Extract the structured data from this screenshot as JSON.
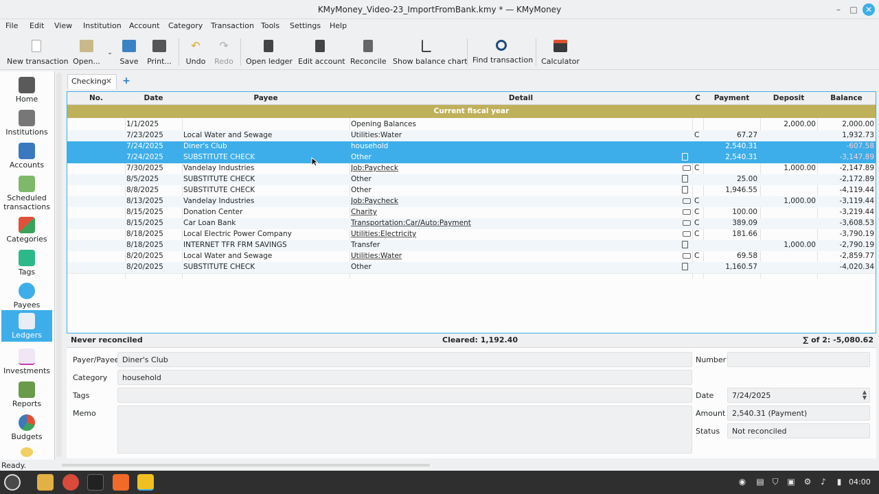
{
  "window": {
    "title": "KMyMoney_Video-23_ImportFromBank.kmy * — KMyMoney"
  },
  "menu": [
    "File",
    "Edit",
    "View",
    "Institution",
    "Account",
    "Category",
    "Transaction",
    "Tools",
    "Settings",
    "Help"
  ],
  "toolbar": {
    "new_transaction": "New transaction",
    "open": "Open...",
    "save": "Save",
    "print": "Print...",
    "undo": "Undo",
    "redo": "Redo",
    "open_ledger": "Open ledger",
    "edit_account": "Edit account",
    "reconcile": "Reconcile",
    "show_balance_chart": "Show balance chart",
    "find_transaction": "Find transaction",
    "calculator": "Calculator"
  },
  "sidebar": [
    {
      "label": "Home",
      "icon": "home-icon"
    },
    {
      "label": "Institutions",
      "icon": "institutions-icon"
    },
    {
      "label": "Accounts",
      "icon": "accounts-icon"
    },
    {
      "label": "Scheduled transactions",
      "icon": "scheduled-icon"
    },
    {
      "label": "Categories",
      "icon": "categories-icon"
    },
    {
      "label": "Tags",
      "icon": "tags-icon"
    },
    {
      "label": "Payees",
      "icon": "payees-icon"
    },
    {
      "label": "Ledgers",
      "icon": "ledgers-icon"
    },
    {
      "label": "Investments",
      "icon": "investments-icon"
    },
    {
      "label": "Reports",
      "icon": "reports-icon"
    },
    {
      "label": "Budgets",
      "icon": "budgets-icon"
    }
  ],
  "tab": {
    "label": "Checking",
    "close": "✕",
    "add": "+"
  },
  "ledger": {
    "columns": [
      "No.",
      "Date",
      "Payee",
      "Detail",
      "C",
      "Payment",
      "Deposit",
      "Balance"
    ],
    "group_header": "Current fiscal year",
    "rows": [
      {
        "date": "1/1/2025",
        "payee": "",
        "detail": "Opening Balances",
        "c": "",
        "payment": "",
        "deposit": "2,000.00",
        "balance": "2,000.00"
      },
      {
        "date": "7/23/2025",
        "payee": "Local Water and Sewage",
        "detail": "Utilities:Water",
        "c": "C",
        "payment": "67.27",
        "deposit": "",
        "balance": "1,932.73"
      },
      {
        "date": "7/24/2025",
        "payee": "Diner's Club",
        "detail": "household",
        "c": "",
        "payment": "2,540.31",
        "deposit": "",
        "balance": "-607.58"
      },
      {
        "date": "7/24/2025",
        "payee": "SUBSTITUTE CHECK",
        "detail": "Other",
        "c": "",
        "payment": "2,540.31",
        "deposit": "",
        "balance": "-3,147.89"
      },
      {
        "date": "7/30/2025",
        "payee": "Vandelay Industries",
        "detail": "Job:Paycheck",
        "c": "C",
        "payment": "",
        "deposit": "1,000.00",
        "balance": "-2,147.89"
      },
      {
        "date": "8/5/2025",
        "payee": "SUBSTITUTE CHECK",
        "detail": "Other",
        "c": "",
        "payment": "25.00",
        "deposit": "",
        "balance": "-2,172.89"
      },
      {
        "date": "8/8/2025",
        "payee": "SUBSTITUTE CHECK",
        "detail": "Other",
        "c": "",
        "payment": "1,946.55",
        "deposit": "",
        "balance": "-4,119.44"
      },
      {
        "date": "8/13/2025",
        "payee": "Vandelay Industries",
        "detail": "Job:Paycheck",
        "c": "C",
        "payment": "",
        "deposit": "1,000.00",
        "balance": "-3,119.44"
      },
      {
        "date": "8/15/2025",
        "payee": "Donation Center",
        "detail": "Charity",
        "c": "C",
        "payment": "100.00",
        "deposit": "",
        "balance": "-3,219.44"
      },
      {
        "date": "8/15/2025",
        "payee": "Car Loan Bank",
        "detail": "Transportation:Car/Auto:Payment",
        "c": "C",
        "payment": "389.09",
        "deposit": "",
        "balance": "-3,608.53"
      },
      {
        "date": "8/18/2025",
        "payee": "Local Electric Power Company",
        "detail": "Utilities:Electricity",
        "c": "C",
        "payment": "181.66",
        "deposit": "",
        "balance": "-3,790.19"
      },
      {
        "date": "8/18/2025",
        "payee": "INTERNET TFR FRM SAVINGS",
        "detail": "Transfer",
        "c": "",
        "payment": "",
        "deposit": "1,000.00",
        "balance": "-2,790.19"
      },
      {
        "date": "8/20/2025",
        "payee": "Local Water and Sewage",
        "detail": "Utilities:Water",
        "c": "C",
        "payment": "69.58",
        "deposit": "",
        "balance": "-2,859.77"
      },
      {
        "date": "8/20/2025",
        "payee": "SUBSTITUTE CHECK",
        "detail": "Other",
        "c": "",
        "payment": "1,160.57",
        "deposit": "",
        "balance": "-4,020.34"
      }
    ]
  },
  "summary": {
    "reconciled": "Never reconciled",
    "cleared": "Cleared: 1,192.40",
    "sum": "∑ of 2: -5,080.62"
  },
  "form": {
    "payee_label": "Payer/Payee",
    "payee_value": "Diner's Club",
    "category_label": "Category",
    "category_value": "household",
    "tags_label": "Tags",
    "tags_value": "",
    "memo_label": "Memo",
    "memo_value": "",
    "number_label": "Number",
    "number_value": "",
    "date_label": "Date",
    "date_value": "7/24/2025",
    "amount_label": "Amount",
    "amount_value": "2,540.31 (Payment)",
    "status_label": "Status",
    "status_value": "Not reconciled"
  },
  "status_bar": "Ready.",
  "clock": "04:00",
  "colors": {
    "accent": "#3daee9",
    "fiscal_header": "#bfb05a"
  }
}
